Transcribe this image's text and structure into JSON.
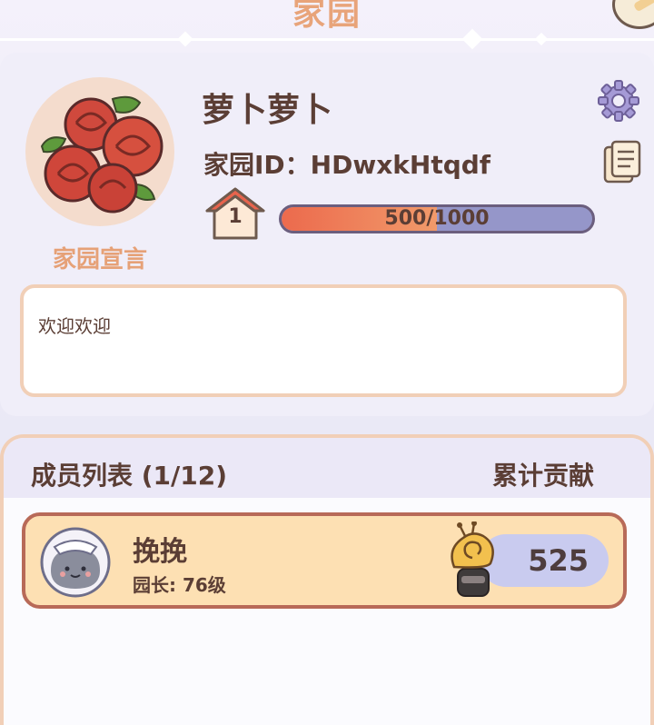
{
  "header": {
    "title": "家园"
  },
  "profile": {
    "username": "萝卜萝卜",
    "home_id": "家园ID：HDwxkHtqdf",
    "level": "1",
    "exp_text": "500/1000",
    "exp_progress": 0.5,
    "manifesto_label": "家园宣言",
    "manifesto_text": "欢迎欢迎"
  },
  "members": {
    "title": "成员列表 (1/12)",
    "contribution_header": "累计贡献",
    "list": [
      {
        "name": "挽挽",
        "role": "园长: 76级",
        "contribution": "525"
      }
    ]
  },
  "colors": {
    "accent_title": "#e8a47a",
    "text_brown": "#5b3e35",
    "exp_fill": "#ec6a4d",
    "member_row_bg": "#fde0b3"
  },
  "icons": [
    "settings-gear-icon",
    "copy-document-icon",
    "house-level-icon",
    "snail-badge-icon",
    "edit-pen-icon"
  ]
}
